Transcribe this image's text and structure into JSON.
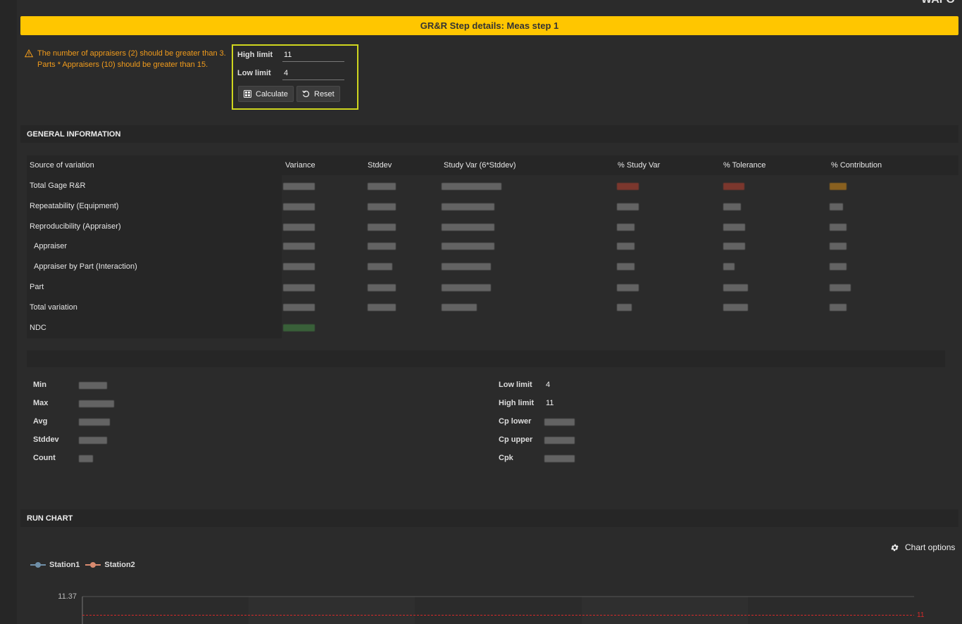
{
  "header": {
    "corner_text": "WAFO",
    "step_title": "GR&R Step details: Meas step 1"
  },
  "warnings": [
    "The number of appraisers (2) should be greater than 3.",
    "Parts * Appraisers (10) should be greater than 15."
  ],
  "limits_form": {
    "high_limit_label": "High limit",
    "high_limit_value": "11",
    "low_limit_label": "Low limit",
    "low_limit_value": "4",
    "calculate_label": "Calculate",
    "reset_label": "Reset"
  },
  "general_info": {
    "title": "GENERAL INFORMATION",
    "columns": [
      "Source of variation",
      "Variance",
      "Stddev",
      "Study Var (6*Stddev)",
      "% Study Var",
      "% Tolerance",
      "% Contribution"
    ],
    "rows": [
      "Total Gage R&R",
      "Repeatability (Equipment)",
      "Reproducibility (Appraiser)",
      "Appraiser",
      "Appraiser by Part (Interaction)",
      "Part",
      "Total variation",
      "NDC"
    ]
  },
  "stats": {
    "left_labels": [
      "Min",
      "Max",
      "Avg",
      "Stddev",
      "Count"
    ],
    "right_labels": [
      "Low limit",
      "High limit",
      "Cp lower",
      "Cp upper",
      "Cpk"
    ],
    "low_limit_value": "4",
    "high_limit_value": "11"
  },
  "run_chart": {
    "title": "RUN CHART",
    "chart_options_label": "Chart options",
    "legend": [
      {
        "name": "Station1",
        "color": "#6f8fa8"
      },
      {
        "name": "Station2",
        "color": "#d98a6f"
      }
    ],
    "y_top_label": "11.37",
    "high_limit_label": "11",
    "limit_line_color": "#d42a2a"
  }
}
